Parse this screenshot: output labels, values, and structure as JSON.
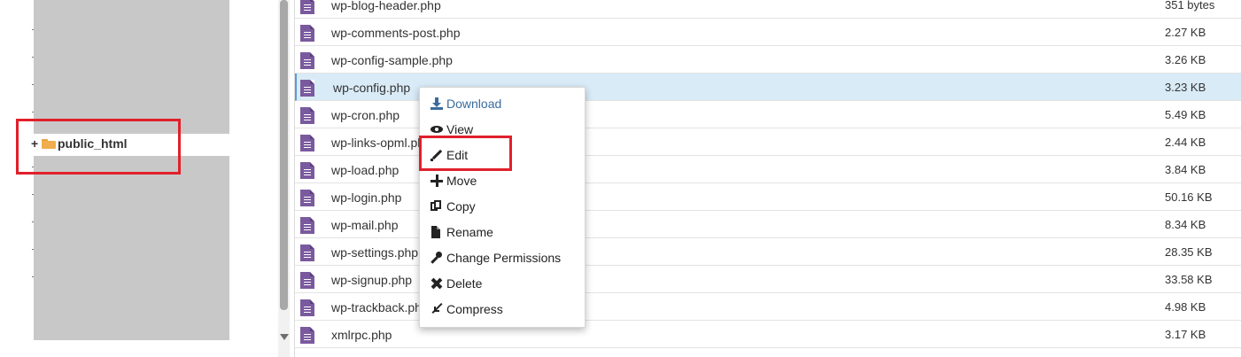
{
  "tree": {
    "selected_folder": "public_html",
    "expand_symbol": "+"
  },
  "files": [
    {
      "name": "wp-blog-header.php",
      "size": "351 bytes"
    },
    {
      "name": "wp-comments-post.php",
      "size": "2.27 KB"
    },
    {
      "name": "wp-config-sample.php",
      "size": "3.26 KB"
    },
    {
      "name": "wp-config.php",
      "size": "3.23 KB"
    },
    {
      "name": "wp-cron.php",
      "size": "5.49 KB"
    },
    {
      "name": "wp-links-opml.php",
      "size": "2.44 KB"
    },
    {
      "name": "wp-load.php",
      "size": "3.84 KB"
    },
    {
      "name": "wp-login.php",
      "size": "50.16 KB"
    },
    {
      "name": "wp-mail.php",
      "size": "8.34 KB"
    },
    {
      "name": "wp-settings.php",
      "size": "28.35 KB"
    },
    {
      "name": "wp-signup.php",
      "size": "33.58 KB"
    },
    {
      "name": "wp-trackback.php",
      "size": "4.98 KB"
    },
    {
      "name": "xmlrpc.php",
      "size": "3.17 KB"
    }
  ],
  "context_menu": {
    "download": "Download",
    "view": "View",
    "edit": "Edit",
    "move": "Move",
    "copy": "Copy",
    "rename": "Rename",
    "change_permissions": "Change Permissions",
    "delete": "Delete",
    "compress": "Compress"
  },
  "colors": {
    "highlight": "#e0202b",
    "selected_row": "#d9ebf7",
    "file_icon": "#7a5a9e",
    "folder": "#f0ad4e",
    "menu_primary": "#3a6c9e"
  }
}
